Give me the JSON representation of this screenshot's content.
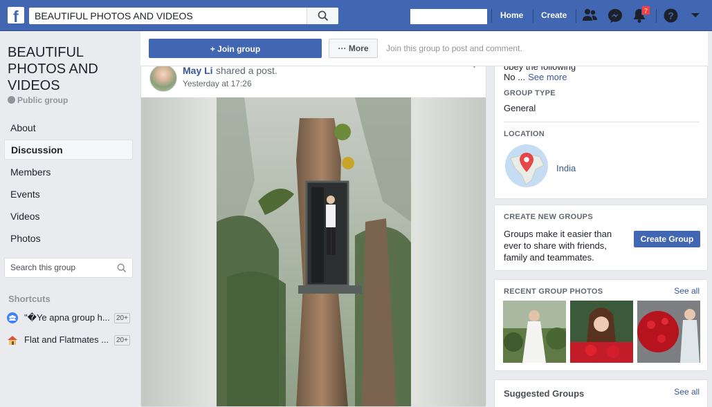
{
  "topbar": {
    "logo_letter": "f",
    "search_value": "BEAUTIFUL PHOTOS AND VIDEOS",
    "nav_home": "Home",
    "nav_create": "Create",
    "notification_count": "7",
    "icons": [
      "facebook-logo",
      "search-icon",
      "friends-icon",
      "messenger-icon",
      "notifications-icon",
      "help-icon",
      "account-menu-icon"
    ],
    "brand_color": "#4267b2"
  },
  "group": {
    "name": "BEAUTIFUL PHOTOS AND VIDEOS",
    "privacy": "Public group"
  },
  "left_nav": {
    "items": [
      "About",
      "Discussion",
      "Members",
      "Events",
      "Videos",
      "Photos"
    ],
    "active_item": "Discussion",
    "search_placeholder": "Search this group",
    "shortcuts_title": "Shortcuts",
    "shortcuts": [
      {
        "label": "\"�Ye apna group h...",
        "count": "20+"
      },
      {
        "label": "Flat and Flatmates ...",
        "count": "20+"
      }
    ]
  },
  "actions": {
    "join_label": "+ Join group",
    "more_label": "··· More",
    "hint": "Join this group to post and comment."
  },
  "post": {
    "author": "May Li",
    "action": "shared a post.",
    "time": "Yesterday at 17:26"
  },
  "about": {
    "rule_text": "obey the following",
    "rule_no": "No ...",
    "see_more": "See more",
    "group_type_label": "GROUP TYPE",
    "group_type_value": "General",
    "location_label": "LOCATION",
    "location_value": "India"
  },
  "create_groups": {
    "title": "CREATE NEW GROUPS",
    "description": "Groups make it easier than ever to share with friends, family and teammates.",
    "button": "Create Group"
  },
  "recent_photos": {
    "title": "RECENT GROUP PHOTOS",
    "see_all": "See all"
  },
  "suggested": {
    "title": "Suggested Groups",
    "see_all": "See all"
  }
}
